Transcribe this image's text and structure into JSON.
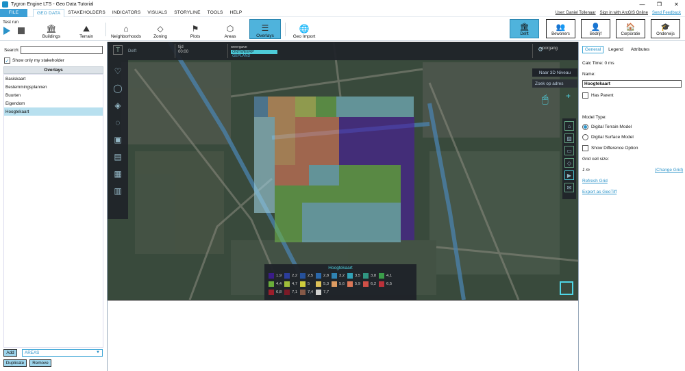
{
  "window": {
    "title": "Tygron Engine LTS - Geo Data Tutorial",
    "controls": [
      "—",
      "❐",
      "✕"
    ]
  },
  "menu": {
    "file": "FILE",
    "items": [
      "GEO DATA",
      "STAKEHOLDERS",
      "INDICATORS",
      "VISUALS",
      "STORYLINE",
      "TOOLS",
      "HELP"
    ],
    "active": "GEO DATA"
  },
  "user": {
    "name": "User: Daniel Tollenaar",
    "arcgis": "Sign in with ArcGIS Online",
    "feedback": "Send Feedback"
  },
  "toolbar": {
    "test_run": "Test run",
    "tools": [
      "Buildings",
      "Terrain",
      "Neighborhoods",
      "Zoning",
      "Plots",
      "Areas",
      "Overlays",
      "Geo Import"
    ],
    "selected": "Overlays"
  },
  "stakeholders": [
    {
      "label": "Delft",
      "icon": "🏛"
    },
    {
      "label": "Bewoners",
      "icon": "👥"
    },
    {
      "label": "Bedrijf",
      "icon": "👤"
    },
    {
      "label": "Corporatie",
      "icon": "🏠"
    },
    {
      "label": "Onderwijs",
      "icon": "🎓"
    }
  ],
  "left": {
    "search_label": "Search:",
    "search_value": "",
    "show_only": "Show only my stakeholder",
    "overlays_header": "Overlays",
    "overlays": [
      "Basiskaart",
      "Bestemmingsplannen",
      "Buurten",
      "Eigendom",
      "Hoogtekaart"
    ],
    "selected_overlay": "Hoogtekaart",
    "add": "Add",
    "areas": "AREAS",
    "duplicate": "Duplicate",
    "remove": "Remove"
  },
  "map": {
    "city": "Delft",
    "tijd_label": "tijd",
    "tijd_value": "00:00",
    "weergave": "weergave",
    "ontwerp": "ONTWEERP",
    "gepland": "GEPLAND",
    "voorgang": "voorgang",
    "naar3d": "Naar 3D Niveau",
    "zoek": "Zoek op adres"
  },
  "legend": {
    "title": "Hoogtekaart",
    "rows": [
      [
        {
          "v": "1,9",
          "c": "#3a1a8c"
        },
        {
          "v": "2,2",
          "c": "#2a3ca0"
        },
        {
          "v": "2,5",
          "c": "#24509e"
        },
        {
          "v": "2,8",
          "c": "#2a6ab0"
        },
        {
          "v": "3,2",
          "c": "#2e86b8"
        },
        {
          "v": "3,5",
          "c": "#31a6bd"
        },
        {
          "v": "3,8",
          "c": "#2f9a86"
        },
        {
          "v": "4,1",
          "c": "#3aa04a"
        }
      ],
      [
        {
          "v": "4,4",
          "c": "#6db23a"
        },
        {
          "v": "4,7",
          "c": "#a6c43a"
        },
        {
          "v": "5",
          "c": "#d6d23a"
        },
        {
          "v": "5,3",
          "c": "#e6c75a"
        },
        {
          "v": "5,6",
          "c": "#e6a064"
        },
        {
          "v": "5,9",
          "c": "#e47a5a"
        },
        {
          "v": "6,2",
          "c": "#d85048"
        },
        {
          "v": "6,5",
          "c": "#c2303a"
        }
      ],
      [
        {
          "v": "6,8",
          "c": "#a01c2a"
        },
        {
          "v": "7,1",
          "c": "#7e1826"
        },
        {
          "v": "7,4",
          "c": "#8a5a48"
        },
        {
          "v": "7,7",
          "c": "#d8d8d8"
        }
      ]
    ]
  },
  "right": {
    "tabs": [
      "General",
      "Legend",
      "Attributes"
    ],
    "selected_tab": "General",
    "calc": "Calc Time: 0 ms",
    "name_label": "Name:",
    "name_value": "Hoogtekaart",
    "has_parent": "Has Parent",
    "model_type": "Model Type:",
    "dtm": "Digital Terrain Model",
    "dsm": "Digital Surface Model",
    "diff": "Show Difference Option",
    "grid_label": "Grid cell size:",
    "grid_value": "1 m",
    "change_grid": "(Change Grid)",
    "refresh": "Refresh Grid",
    "export": "Export as GeoTiff"
  }
}
